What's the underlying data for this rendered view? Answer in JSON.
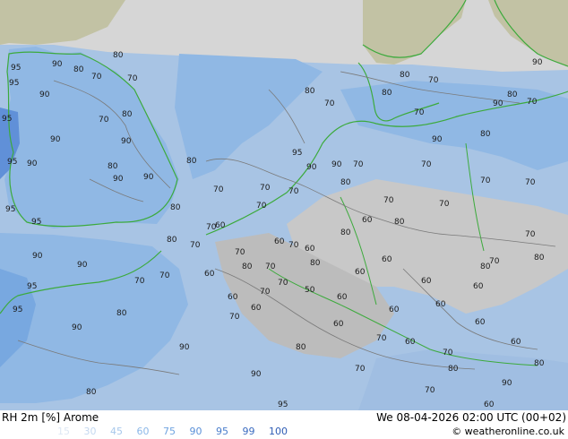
{
  "map": {
    "contour_labels": [
      "95",
      "90",
      "80",
      "70",
      "60",
      "50"
    ],
    "colors": {
      "outside_domain_land": "#c2c2a4",
      "outside_domain_sea": "#d8d8d8",
      "rh_60": "#c8c8c8",
      "rh_70": "#a8c4e4",
      "rh_80": "#90b8e4",
      "rh_90": "#78a8e0",
      "rh_95": "#6090d8",
      "coastline": "#3caa3c",
      "contour": "#7a7a7a"
    }
  },
  "footer": {
    "title": "RH 2m [%] Arome",
    "datetime": "We 08-04-2026 02:00 UTC (00+02)",
    "copyright": "© weatheronline.co.uk",
    "legend": [
      {
        "label": "15",
        "color": "#dfe8f4"
      },
      {
        "label": "30",
        "color": "#c4d8f0"
      },
      {
        "label": "45",
        "color": "#a8c8ec"
      },
      {
        "label": "60",
        "color": "#8cb8e8"
      },
      {
        "label": "75",
        "color": "#70a4e0"
      },
      {
        "label": "90",
        "color": "#5a90d8"
      },
      {
        "label": "95",
        "color": "#4a7ecc"
      },
      {
        "label": "99",
        "color": "#3c6cc0"
      },
      {
        "label": "100",
        "color": "#2e5cb4"
      }
    ]
  }
}
